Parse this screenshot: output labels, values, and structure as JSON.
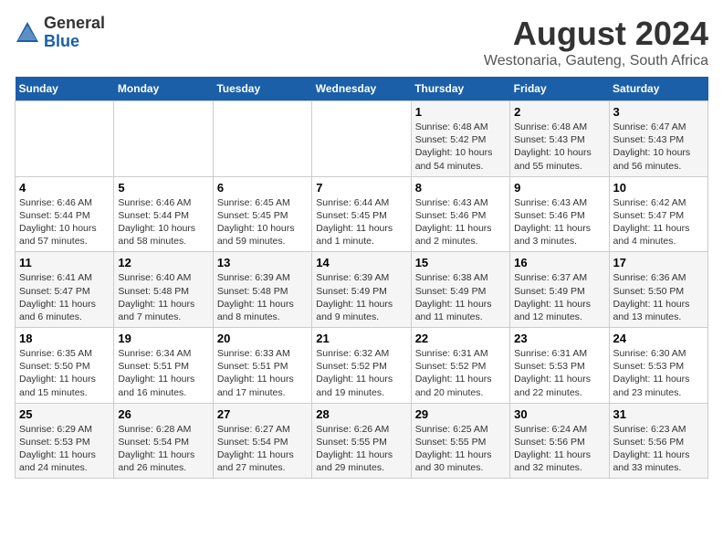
{
  "header": {
    "logo_line1": "General",
    "logo_line2": "Blue",
    "main_title": "August 2024",
    "subtitle": "Westonaria, Gauteng, South Africa"
  },
  "weekdays": [
    "Sunday",
    "Monday",
    "Tuesday",
    "Wednesday",
    "Thursday",
    "Friday",
    "Saturday"
  ],
  "weeks": [
    [
      {
        "day": "",
        "detail": ""
      },
      {
        "day": "",
        "detail": ""
      },
      {
        "day": "",
        "detail": ""
      },
      {
        "day": "",
        "detail": ""
      },
      {
        "day": "1",
        "detail": "Sunrise: 6:48 AM\nSunset: 5:42 PM\nDaylight: 10 hours\nand 54 minutes."
      },
      {
        "day": "2",
        "detail": "Sunrise: 6:48 AM\nSunset: 5:43 PM\nDaylight: 10 hours\nand 55 minutes."
      },
      {
        "day": "3",
        "detail": "Sunrise: 6:47 AM\nSunset: 5:43 PM\nDaylight: 10 hours\nand 56 minutes."
      }
    ],
    [
      {
        "day": "4",
        "detail": "Sunrise: 6:46 AM\nSunset: 5:44 PM\nDaylight: 10 hours\nand 57 minutes."
      },
      {
        "day": "5",
        "detail": "Sunrise: 6:46 AM\nSunset: 5:44 PM\nDaylight: 10 hours\nand 58 minutes."
      },
      {
        "day": "6",
        "detail": "Sunrise: 6:45 AM\nSunset: 5:45 PM\nDaylight: 10 hours\nand 59 minutes."
      },
      {
        "day": "7",
        "detail": "Sunrise: 6:44 AM\nSunset: 5:45 PM\nDaylight: 11 hours\nand 1 minute."
      },
      {
        "day": "8",
        "detail": "Sunrise: 6:43 AM\nSunset: 5:46 PM\nDaylight: 11 hours\nand 2 minutes."
      },
      {
        "day": "9",
        "detail": "Sunrise: 6:43 AM\nSunset: 5:46 PM\nDaylight: 11 hours\nand 3 minutes."
      },
      {
        "day": "10",
        "detail": "Sunrise: 6:42 AM\nSunset: 5:47 PM\nDaylight: 11 hours\nand 4 minutes."
      }
    ],
    [
      {
        "day": "11",
        "detail": "Sunrise: 6:41 AM\nSunset: 5:47 PM\nDaylight: 11 hours\nand 6 minutes."
      },
      {
        "day": "12",
        "detail": "Sunrise: 6:40 AM\nSunset: 5:48 PM\nDaylight: 11 hours\nand 7 minutes."
      },
      {
        "day": "13",
        "detail": "Sunrise: 6:39 AM\nSunset: 5:48 PM\nDaylight: 11 hours\nand 8 minutes."
      },
      {
        "day": "14",
        "detail": "Sunrise: 6:39 AM\nSunset: 5:49 PM\nDaylight: 11 hours\nand 9 minutes."
      },
      {
        "day": "15",
        "detail": "Sunrise: 6:38 AM\nSunset: 5:49 PM\nDaylight: 11 hours\nand 11 minutes."
      },
      {
        "day": "16",
        "detail": "Sunrise: 6:37 AM\nSunset: 5:49 PM\nDaylight: 11 hours\nand 12 minutes."
      },
      {
        "day": "17",
        "detail": "Sunrise: 6:36 AM\nSunset: 5:50 PM\nDaylight: 11 hours\nand 13 minutes."
      }
    ],
    [
      {
        "day": "18",
        "detail": "Sunrise: 6:35 AM\nSunset: 5:50 PM\nDaylight: 11 hours\nand 15 minutes."
      },
      {
        "day": "19",
        "detail": "Sunrise: 6:34 AM\nSunset: 5:51 PM\nDaylight: 11 hours\nand 16 minutes."
      },
      {
        "day": "20",
        "detail": "Sunrise: 6:33 AM\nSunset: 5:51 PM\nDaylight: 11 hours\nand 17 minutes."
      },
      {
        "day": "21",
        "detail": "Sunrise: 6:32 AM\nSunset: 5:52 PM\nDaylight: 11 hours\nand 19 minutes."
      },
      {
        "day": "22",
        "detail": "Sunrise: 6:31 AM\nSunset: 5:52 PM\nDaylight: 11 hours\nand 20 minutes."
      },
      {
        "day": "23",
        "detail": "Sunrise: 6:31 AM\nSunset: 5:53 PM\nDaylight: 11 hours\nand 22 minutes."
      },
      {
        "day": "24",
        "detail": "Sunrise: 6:30 AM\nSunset: 5:53 PM\nDaylight: 11 hours\nand 23 minutes."
      }
    ],
    [
      {
        "day": "25",
        "detail": "Sunrise: 6:29 AM\nSunset: 5:53 PM\nDaylight: 11 hours\nand 24 minutes."
      },
      {
        "day": "26",
        "detail": "Sunrise: 6:28 AM\nSunset: 5:54 PM\nDaylight: 11 hours\nand 26 minutes."
      },
      {
        "day": "27",
        "detail": "Sunrise: 6:27 AM\nSunset: 5:54 PM\nDaylight: 11 hours\nand 27 minutes."
      },
      {
        "day": "28",
        "detail": "Sunrise: 6:26 AM\nSunset: 5:55 PM\nDaylight: 11 hours\nand 29 minutes."
      },
      {
        "day": "29",
        "detail": "Sunrise: 6:25 AM\nSunset: 5:55 PM\nDaylight: 11 hours\nand 30 minutes."
      },
      {
        "day": "30",
        "detail": "Sunrise: 6:24 AM\nSunset: 5:56 PM\nDaylight: 11 hours\nand 32 minutes."
      },
      {
        "day": "31",
        "detail": "Sunrise: 6:23 AM\nSunset: 5:56 PM\nDaylight: 11 hours\nand 33 minutes."
      }
    ]
  ]
}
